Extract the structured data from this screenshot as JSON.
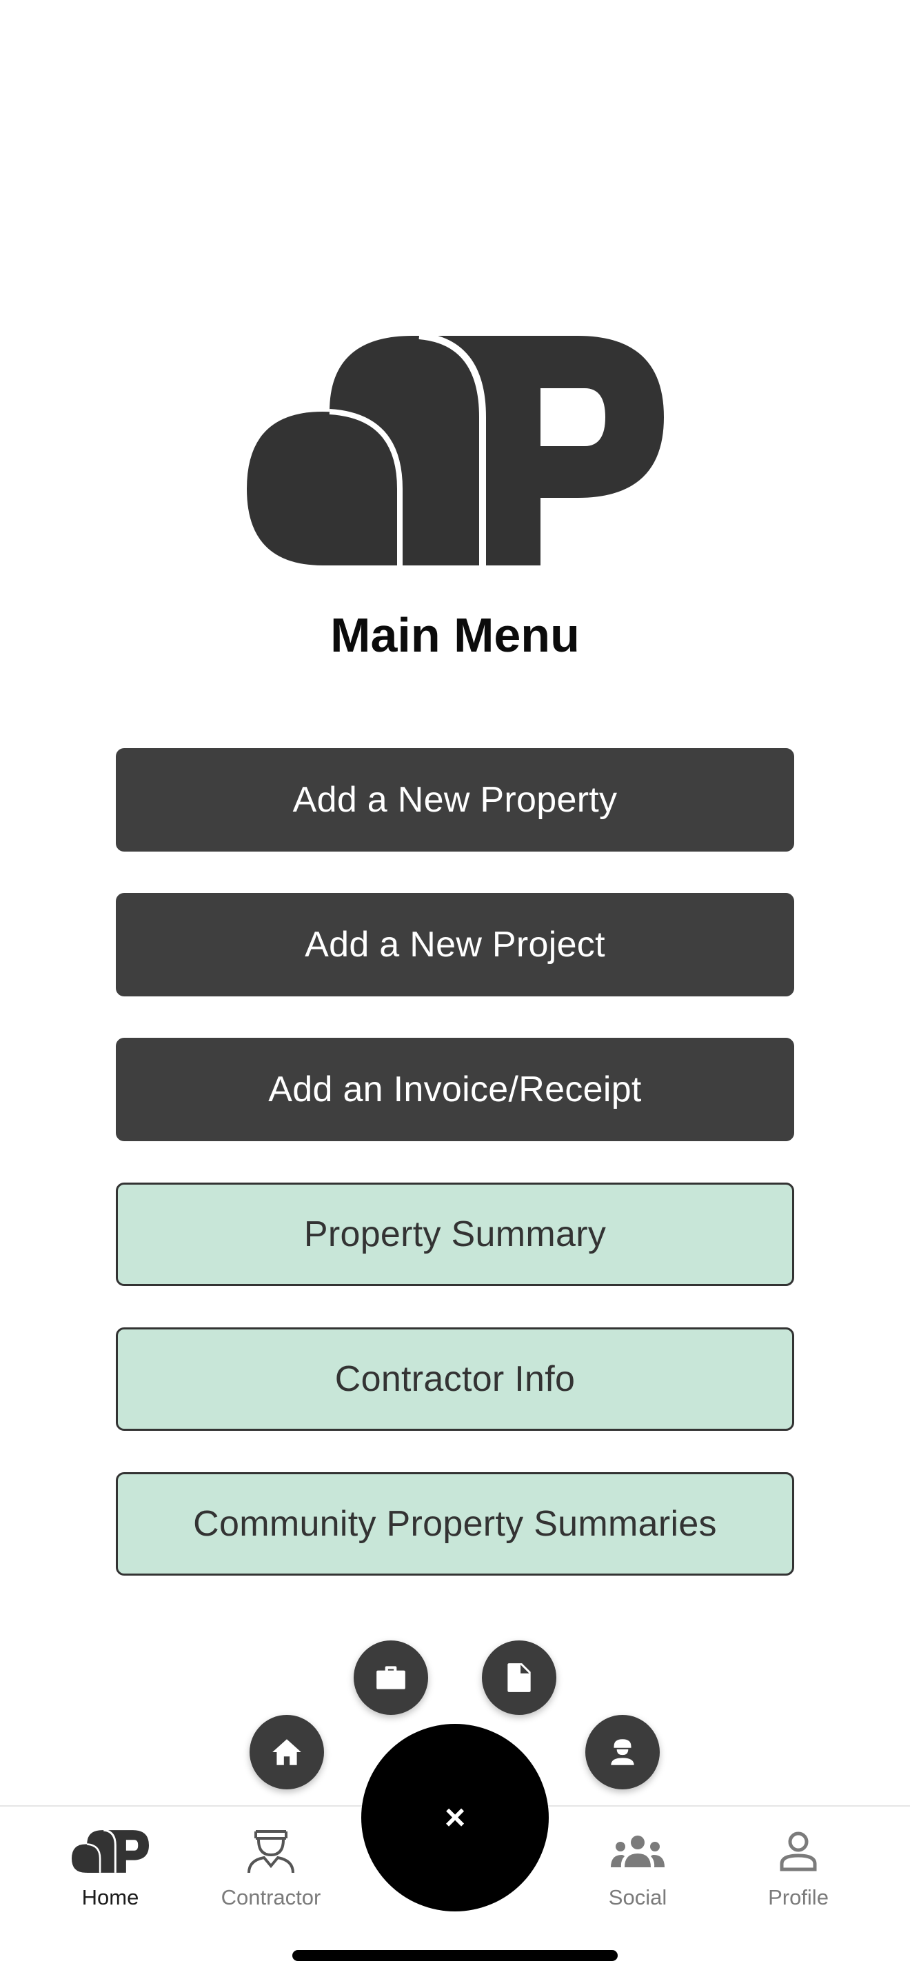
{
  "header": {
    "title": "Main Menu"
  },
  "menu": {
    "add_property": "Add a New Property",
    "add_project": "Add a New Project",
    "add_invoice": "Add an Invoice/Receipt",
    "property_summary": "Property Summary",
    "contractor_info": "Contractor Info",
    "community_summaries": "Community Property Summaries"
  },
  "fab": {
    "close_glyph": "×"
  },
  "quick_actions": [
    "home-icon",
    "briefcase-icon",
    "document-icon",
    "worker-icon"
  ],
  "tabbar": {
    "home": "Home",
    "contractor": "Contractor",
    "social": "Social",
    "profile": "Profile"
  },
  "colors": {
    "dark_button": "#3f3f3f",
    "light_button": "#c8e6d8",
    "logo": "#333333",
    "tab_active": "#1c1c1c",
    "tab_inactive": "#7b7b7b"
  }
}
